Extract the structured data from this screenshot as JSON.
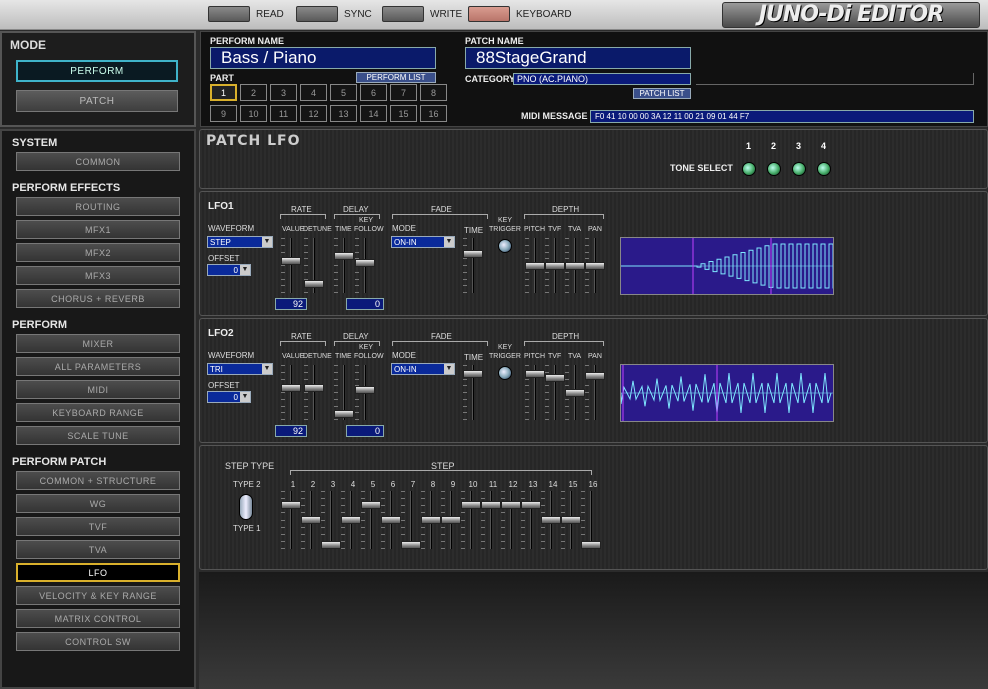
{
  "topbar": {
    "read": "READ",
    "sync": "SYNC",
    "write": "WRITE",
    "keyboard": "KEYBOARD",
    "logo": "JUNO-Di EDITOR"
  },
  "mode": {
    "title": "MODE",
    "perform": "PERFORM",
    "patch": "PATCH"
  },
  "header": {
    "perform_name_label": "PERFORM NAME",
    "perform_name": "Bass / Piano",
    "perform_list": "PERFORM LIST",
    "part_label": "PART",
    "parts": [
      "1",
      "2",
      "3",
      "4",
      "5",
      "6",
      "7",
      "8",
      "9",
      "10",
      "11",
      "12",
      "13",
      "14",
      "15",
      "16"
    ],
    "patch_name_label": "PATCH NAME",
    "patch_name": "88StageGrand",
    "category_label": "CATEGORY",
    "category": "PNO (AC.PIANO)",
    "patch_list": "PATCH LIST",
    "midi_label": "MIDI MESSAGE",
    "midi": "F0 41 10 00 00 3A 12 11 00 21 09 01 44 F7"
  },
  "sidebar": {
    "system": "SYSTEM",
    "common": "COMMON",
    "perform_effects": "PERFORM EFFECTS",
    "routing": "ROUTING",
    "mfx1": "MFX1",
    "mfx2": "MFX2",
    "mfx3": "MFX3",
    "chorus_reverb": "CHORUS + REVERB",
    "perform": "PERFORM",
    "mixer": "MIXER",
    "all_params": "ALL PARAMETERS",
    "midi": "MIDI",
    "keyboard_range": "KEYBOARD RANGE",
    "scale_tune": "SCALE TUNE",
    "perform_patch": "PERFORM PATCH",
    "common_structure": "COMMON + STRUCTURE",
    "wg": "WG",
    "tvf": "TVF",
    "tva": "TVA",
    "lfo": "LFO",
    "velocity_key_range": "VELOCITY & KEY RANGE",
    "matrix_control": "MATRIX CONTROL",
    "control_sw": "CONTROL SW"
  },
  "page": {
    "title": "PATCH LFO",
    "tone_select": "TONE SELECT",
    "tones": [
      "1",
      "2",
      "3",
      "4"
    ]
  },
  "labels": {
    "rate": "RATE",
    "delay": "DELAY",
    "fade": "FADE",
    "depth": "DEPTH",
    "waveform": "WAVEFORM",
    "offset": "OFFSET",
    "value": "VALUE",
    "detune": "DETUNE",
    "time": "TIME",
    "key_follow_1": "KEY",
    "key_follow_2": "FOLLOW",
    "mode": "MODE",
    "key": "KEY",
    "trigger": "TRIGGER",
    "pitch": "PITCH",
    "tvf": "TVF",
    "tva": "TVA",
    "pan": "PAN"
  },
  "lfo1": {
    "title": "LFO1",
    "waveform": "STEP",
    "offset": "0",
    "mode": "ON-IN",
    "rate_value": "92",
    "key_follow": "0",
    "slider_levels": {
      "value": 0.6,
      "detune": 0.1,
      "delay_time": 0.7,
      "key_follow": 0.55,
      "fade_time": 0.75,
      "pitch": 0.5,
      "tvf": 0.5,
      "tva": 0.5,
      "pan": 0.5
    }
  },
  "lfo2": {
    "title": "LFO2",
    "waveform": "TRI",
    "offset": "0",
    "mode": "ON-IN",
    "rate_value": "92",
    "key_follow": "0",
    "slider_levels": {
      "value": 0.6,
      "detune": 0.6,
      "delay_time": 0.05,
      "key_follow": 0.55,
      "fade_time": 0.9,
      "pitch": 0.9,
      "tvf": 0.8,
      "tva": 0.5,
      "pan": 0.85
    }
  },
  "step": {
    "type_label": "STEP TYPE",
    "type2": "TYPE 2",
    "type1": "TYPE 1",
    "step_label": "STEP",
    "numbers": [
      "1",
      "2",
      "3",
      "4",
      "5",
      "6",
      "7",
      "8",
      "9",
      "10",
      "11",
      "12",
      "13",
      "14",
      "15",
      "16"
    ],
    "levels": [
      0.8,
      0.5,
      0.0,
      0.5,
      0.8,
      0.5,
      0.0,
      0.5,
      0.5,
      0.8,
      0.8,
      0.8,
      0.8,
      0.5,
      0.5,
      0.0
    ]
  }
}
